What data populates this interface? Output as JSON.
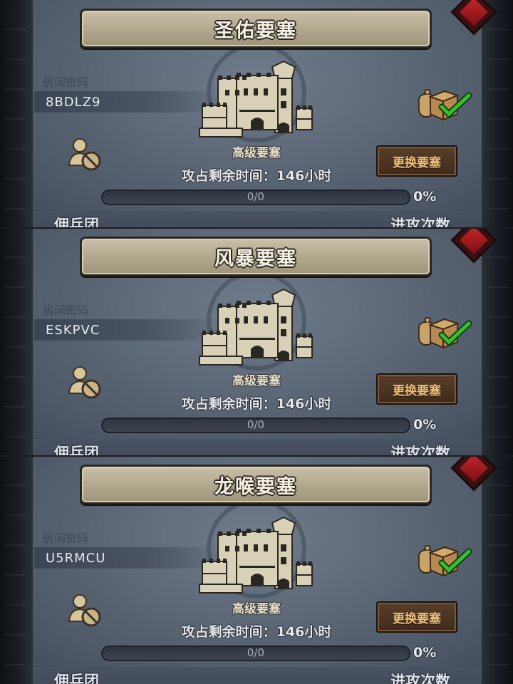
{
  "labels": {
    "password": "房间密码",
    "fort_level": "高级要塞",
    "change_button": "更换要塞",
    "mercenary": "佣兵团",
    "attack_count": "进攻次数"
  },
  "panels": [
    {
      "title": "圣佑要塞",
      "password": "8BDLZ9",
      "timer": "攻占剩余时间：146小时",
      "progress_text": "0/0",
      "progress_fraction": 0,
      "percent": "0%"
    },
    {
      "title": "风暴要塞",
      "password": "ESKPVC",
      "timer": "攻占剩余时间：146小时",
      "progress_text": "0/0",
      "progress_fraction": 0,
      "percent": "0%"
    },
    {
      "title": "龙喉要塞",
      "password": "U5RMCU",
      "timer": "攻占剩余时间：146小时",
      "progress_text": "0/0",
      "progress_fraction": 0,
      "percent": "0%"
    }
  ],
  "icons": {
    "castle": "castle-icon",
    "no_user": "no-user-icon",
    "reward": "reward-crate-icon",
    "check": "check-icon",
    "close": "close-icon"
  },
  "colors": {
    "button_text": "#f3c27a",
    "check": "#35c12a",
    "close": "#c4262a"
  }
}
